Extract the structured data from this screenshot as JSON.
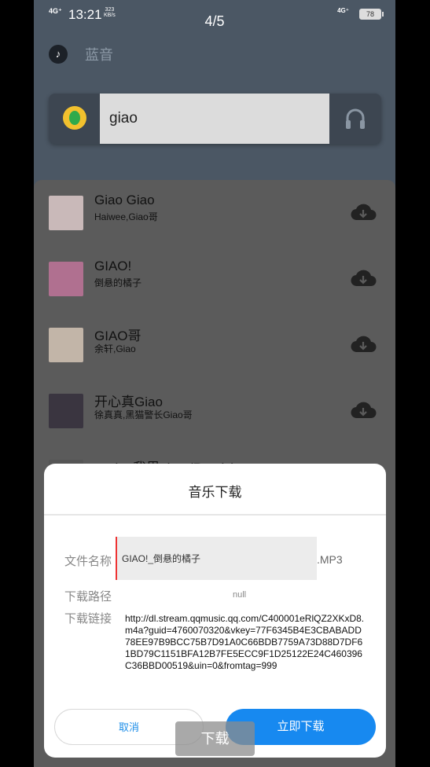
{
  "status_bar": {
    "signal_left": "4G⁺",
    "time": "13:21",
    "speed_value": "323",
    "speed_unit": "KB/s",
    "page_indicator": "4/5",
    "signal_right": "4G⁺",
    "battery": "78"
  },
  "header": {
    "app_name": "蓝音",
    "app_icon": "music-note-icon"
  },
  "search": {
    "value": "giao",
    "left_icon": "qq-music-logo",
    "right_icon": "headphones-icon"
  },
  "songs": [
    {
      "title": "Giao Giao",
      "artist": "Haiwee,Giao哥",
      "cover_color": "#c9b9b9",
      "download_icon": "cloud-download-icon"
    },
    {
      "title": "GIAO!",
      "artist": "倒悬的橘子",
      "cover_color": "#b07090",
      "download_icon": "cloud-download-icon"
    },
    {
      "title": "GIAO哥",
      "artist": "余轩,Giao",
      "cover_color": "#c2b5a8",
      "download_icon": "cloud-download-icon"
    },
    {
      "title": "开心真Giao",
      "artist": "徐真真,黑猫警长Giao哥",
      "cover_color": "#3a3540",
      "download_icon": "cloud-download-icon"
    },
    {
      "title": "一giao我里giao (Remix)",
      "artist": "",
      "cover_color": "#555555",
      "download_icon": "cloud-download-icon"
    }
  ],
  "dialog": {
    "title": "音乐下载",
    "filename_label": "文件名称",
    "filename_value": "GIAO!_倒悬的橘子",
    "extension": ".MP3",
    "path_label": "下载路径",
    "path_value": "null",
    "link_label": "下载链接",
    "link_value": "http://dl.stream.qqmusic.qq.com/C400001eRlQZ2XKxD8.m4a?guid=4760070320&vkey=77F6345B4E3CBABADD78EE97B9BCC75B7D91A0C66BDB7759A73D88D7DF61BD79C1151BFA12B7FE5ECC9F1D25122E24C460396C36BBD00519&uin=0&fromtag=999",
    "cancel_label": "取消",
    "confirm_label": "立即下载"
  },
  "floating_button": {
    "label": "下载"
  },
  "colors": {
    "accent": "#1789f0",
    "screen_bg": "#4b5764",
    "list_bg": "#5b5b5b"
  }
}
